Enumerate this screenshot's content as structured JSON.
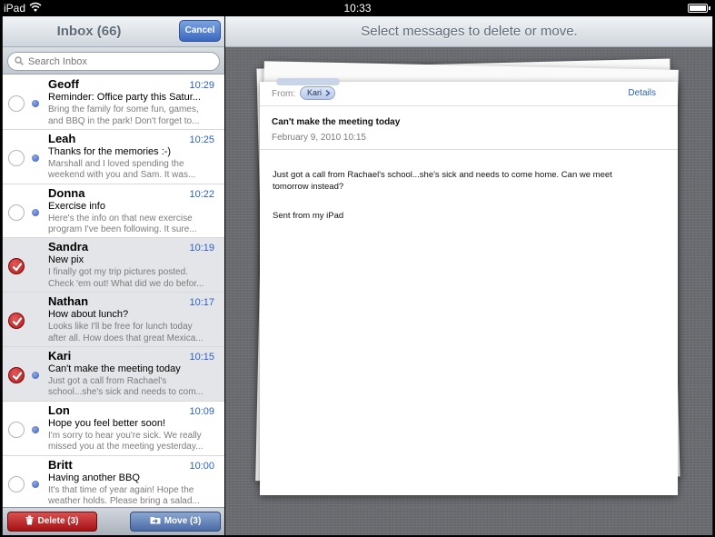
{
  "status_bar": {
    "carrier": "iPad",
    "time": "10:33"
  },
  "inbox": {
    "title": "Inbox (66)",
    "cancel_label": "Cancel",
    "search_placeholder": "Search Inbox",
    "messages": [
      {
        "sender": "Geoff",
        "time": "10:29",
        "subject": "Reminder: Office party this Satur...",
        "preview": "Bring the family for some fun, games, and BBQ in the park! Don't forget to...",
        "selected": false,
        "unread": true
      },
      {
        "sender": "Leah",
        "time": "10:25",
        "subject": "Thanks for the memories :-)",
        "preview": "Marshall and I loved spending the weekend with you and Sam. It was...",
        "selected": false,
        "unread": true
      },
      {
        "sender": "Donna",
        "time": "10:22",
        "subject": "Exercise info",
        "preview": "Here's the info on that new exercise program I've been following. It sure...",
        "selected": false,
        "unread": true
      },
      {
        "sender": "Sandra",
        "time": "10:19",
        "subject": "New pix",
        "preview": "I finally got my trip pictures posted. Check 'em out! What did we do befor...",
        "selected": true,
        "unread": false
      },
      {
        "sender": "Nathan",
        "time": "10:17",
        "subject": "How about lunch?",
        "preview": "Looks like I'll be free for lunch today after all. How does that great Mexica...",
        "selected": true,
        "unread": false
      },
      {
        "sender": "Kari",
        "time": "10:15",
        "subject": "Can't make the meeting today",
        "preview": "Just got a call from Rachael's school...she's sick and needs to com...",
        "selected": true,
        "unread": true
      },
      {
        "sender": "Lon",
        "time": "10:09",
        "subject": "Hope you feel better soon!",
        "preview": "I'm sorry to hear you're sick. We really missed you at the meeting yesterday...",
        "selected": false,
        "unread": true
      },
      {
        "sender": "Britt",
        "time": "10:00",
        "subject": "Having another BBQ",
        "preview": "It's that time of year again! Hope the weather holds. Please bring a salad...",
        "selected": false,
        "unread": true
      }
    ],
    "delete_label": "Delete (3)",
    "move_label": "Move (3)"
  },
  "detail": {
    "prompt": "Select messages to delete or move.",
    "from_label": "From:",
    "from_name": "Kari",
    "details_link": "Details",
    "subject": "Can't make the meeting today",
    "date": "February 9, 2010 10:15",
    "body": "Just got a call from Rachael's school...she's sick and needs to come home. Can we meet tomorrow instead?",
    "signature": "Sent from my iPad"
  },
  "colors": {
    "accent_blue": "#2b5fc7",
    "delete_red": "#a51214",
    "unread_dot": "#3a5cc0",
    "selected_row": "#e3e5e8"
  }
}
